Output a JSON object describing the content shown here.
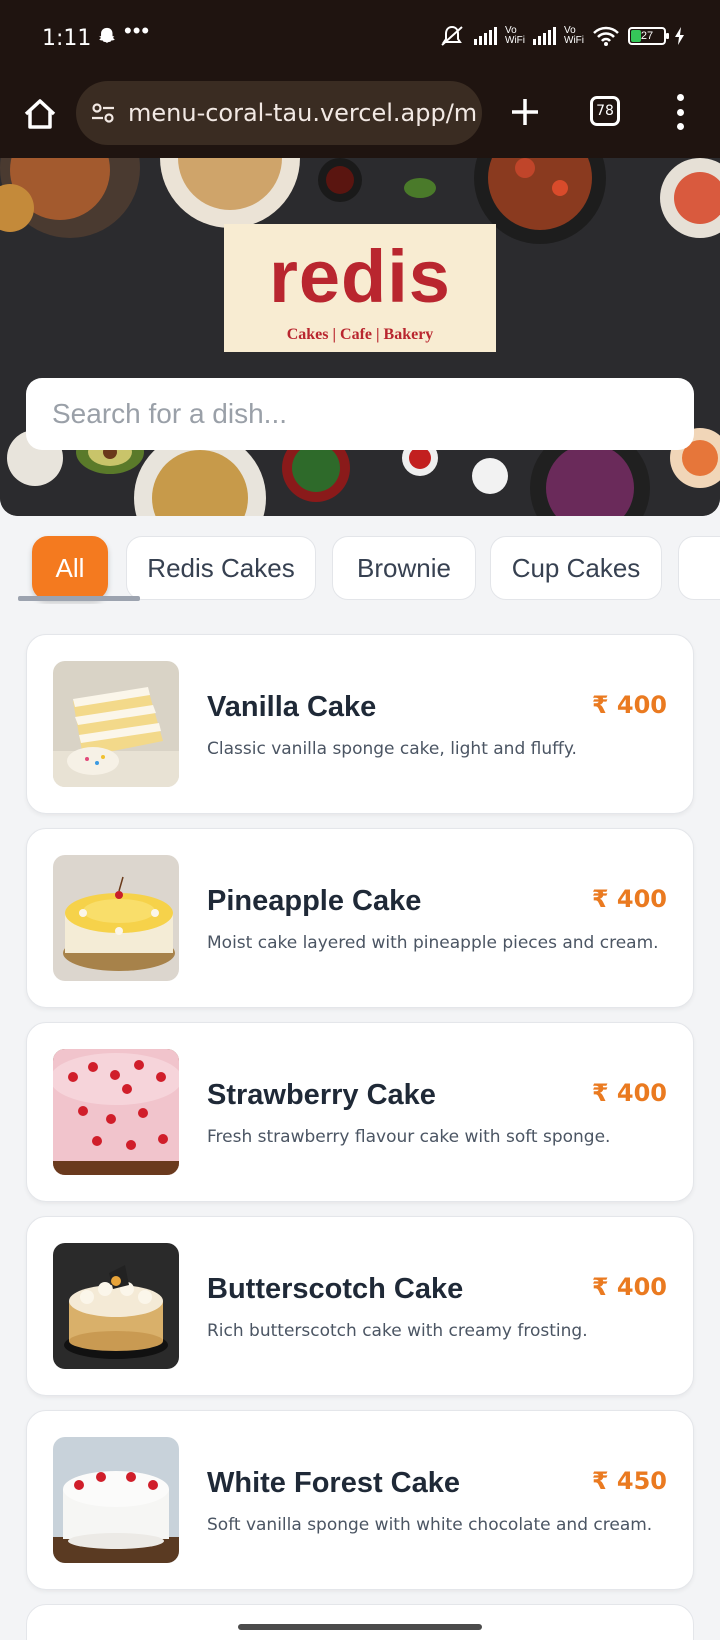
{
  "status": {
    "time": "1:11",
    "battery": "27"
  },
  "browser": {
    "url": "menu-coral-tau.vercel.app/m",
    "tab_count": "78"
  },
  "hero": {
    "logo_word": "redis",
    "logo_tagline": "Cakes | Cafe | Bakery",
    "search_placeholder": "Search for a dish..."
  },
  "categories": [
    {
      "label": "All",
      "active": true
    },
    {
      "label": "Redis Cakes",
      "active": false
    },
    {
      "label": "Brownie",
      "active": false
    },
    {
      "label": "Cup Cakes",
      "active": false
    }
  ],
  "items": [
    {
      "name": "Vanilla Cake",
      "price": "₹ 400",
      "desc": "Classic vanilla sponge cake, light and fluffy."
    },
    {
      "name": "Pineapple Cake",
      "price": "₹ 400",
      "desc": "Moist cake layered with pineapple pieces and cream."
    },
    {
      "name": "Strawberry Cake",
      "price": "₹ 400",
      "desc": "Fresh strawberry flavour cake with soft sponge."
    },
    {
      "name": "Butterscotch Cake",
      "price": "₹ 400",
      "desc": "Rich butterscotch cake with creamy frosting."
    },
    {
      "name": "White Forest Cake",
      "price": "₹ 450",
      "desc": "Soft vanilla sponge with white chocolate and cream."
    }
  ],
  "colors": {
    "accent": "#f47a1f",
    "price": "#ea7a20",
    "brand_red": "#b9262f",
    "chrome": "#1f1410"
  }
}
